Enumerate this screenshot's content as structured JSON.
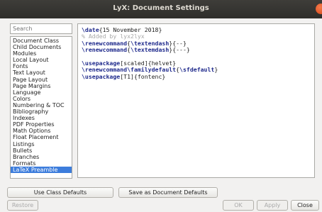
{
  "window": {
    "title": "LyX: Document Settings"
  },
  "search": {
    "placeholder": "Search"
  },
  "sidebar": {
    "items": [
      "Document Class",
      "Child Documents",
      "Modules",
      "Local Layout",
      "Fonts",
      "Text Layout",
      "Page Layout",
      "Page Margins",
      "Language",
      "Colors",
      "Numbering & TOC",
      "Bibliography",
      "Indexes",
      "PDF Properties",
      "Math Options",
      "Float Placement",
      "Listings",
      "Bullets",
      "Branches",
      "Formats",
      "LaTeX Preamble"
    ],
    "selected": "LaTeX Preamble"
  },
  "editor": {
    "lines": [
      [
        {
          "t": "cmd",
          "v": "\\date"
        },
        {
          "t": "txt",
          "v": "{15 November 2018}"
        }
      ],
      [
        {
          "t": "cmt",
          "v": "% Added by lyx2lyx"
        }
      ],
      [
        {
          "t": "cmd",
          "v": "\\renewcommand"
        },
        {
          "t": "txt",
          "v": "{"
        },
        {
          "t": "cmd",
          "v": "\\textendash"
        },
        {
          "t": "txt",
          "v": "}{--}"
        }
      ],
      [
        {
          "t": "cmd",
          "v": "\\renewcommand"
        },
        {
          "t": "txt",
          "v": "{"
        },
        {
          "t": "cmd",
          "v": "\\textemdash"
        },
        {
          "t": "txt",
          "v": "}{---}"
        }
      ],
      [],
      [
        {
          "t": "cmd",
          "v": "\\usepackage"
        },
        {
          "t": "txt",
          "v": "[scaled]{helvet}"
        }
      ],
      [
        {
          "t": "cmd",
          "v": "\\renewcommand"
        },
        {
          "t": "cmd",
          "v": "\\familydefault"
        },
        {
          "t": "txt",
          "v": "{"
        },
        {
          "t": "cmd",
          "v": "\\sfdefault"
        },
        {
          "t": "txt",
          "v": "}"
        }
      ],
      [
        {
          "t": "cmd",
          "v": "\\usepackage"
        },
        {
          "t": "txt",
          "v": "[T1]{fontenc}"
        }
      ]
    ]
  },
  "buttons": {
    "use_class_defaults": "Use Class Defaults",
    "save_as_defaults": "Save as Document Defaults",
    "restore": "Restore",
    "ok": "OK",
    "apply": "Apply",
    "close": "Close"
  }
}
